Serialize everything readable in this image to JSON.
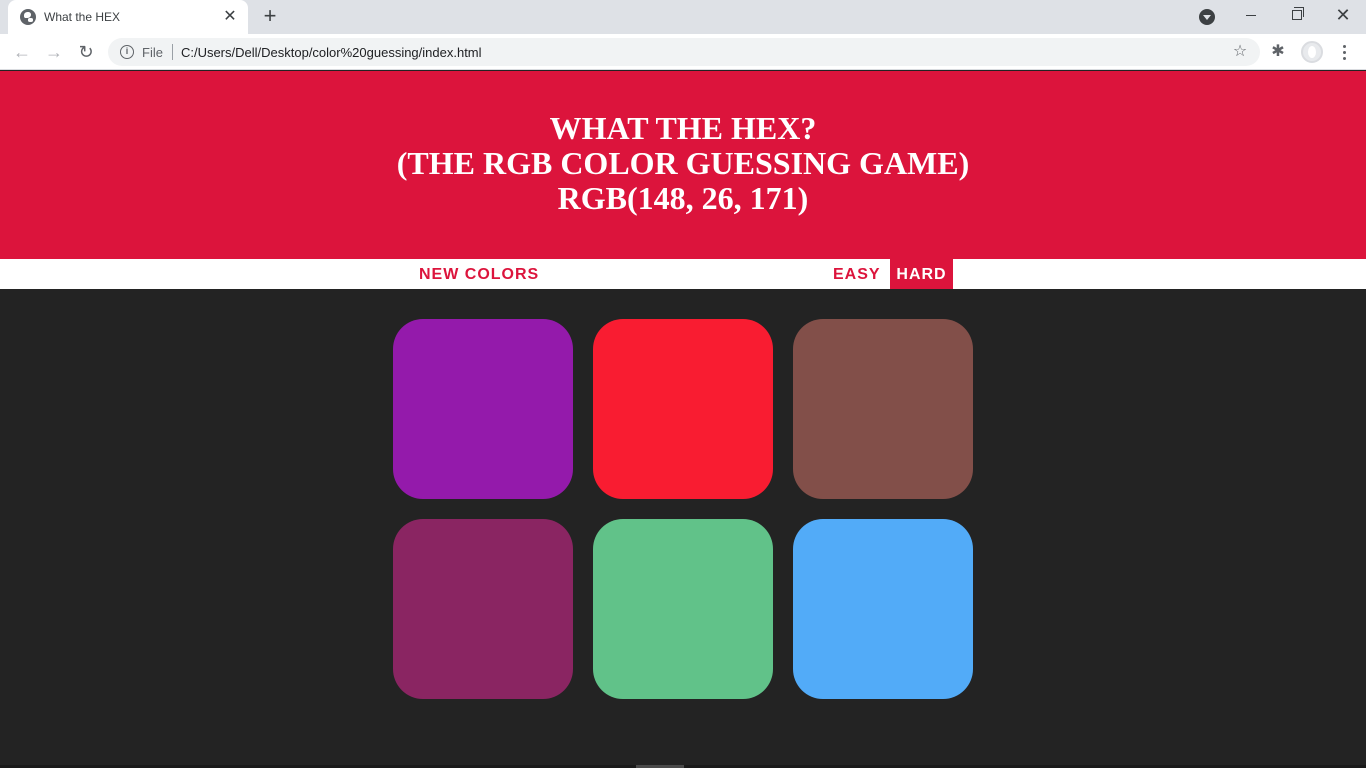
{
  "browser": {
    "tab_title": "What the HEX",
    "tab_close": "✕",
    "new_tab": "+",
    "scheme": "File",
    "url": "C:/Users/Dell/Desktop/color%20guessing/index.html",
    "info": "i",
    "back": "←",
    "forward": "→",
    "reload": "↻",
    "star": "☆",
    "extensions": "✱",
    "window_close": "✕"
  },
  "header": {
    "line1": "WHAT THE HEX?",
    "line2": "(THE RGB COLOR GUESSING GAME)",
    "target_rgb": "RGB(148, 26, 171)"
  },
  "controls": {
    "new_colors": "NEW COLORS",
    "easy": "EASY",
    "hard": "HARD",
    "selected_mode": "hard"
  },
  "colors": {
    "header_bg": "#dc143c",
    "page_bg": "#232323",
    "squares": [
      "#941aab",
      "#f91c31",
      "#824f49",
      "#8a2562",
      "#61c289",
      "#52abf8"
    ]
  }
}
